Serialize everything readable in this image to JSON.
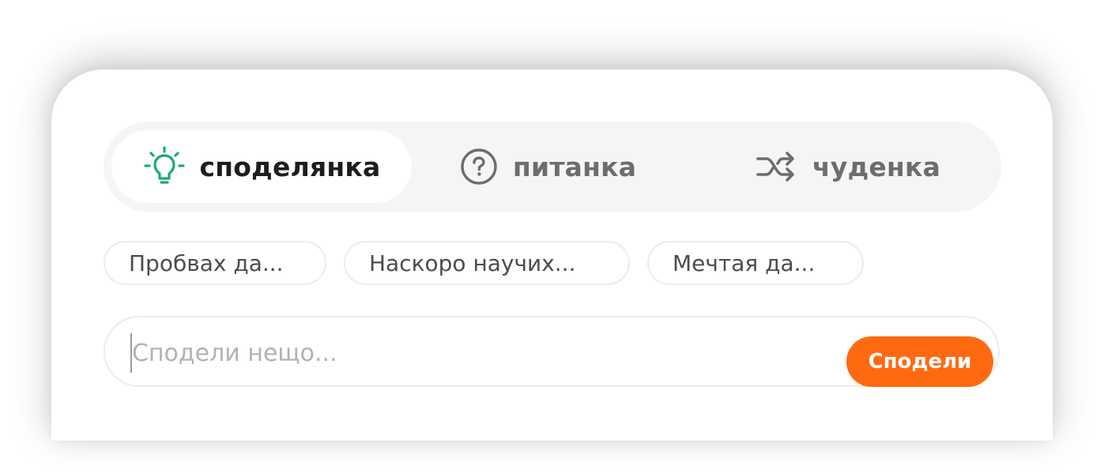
{
  "tabs": [
    {
      "label": "споделянка",
      "icon": "lightbulb-icon",
      "active": true
    },
    {
      "label": "питанка",
      "icon": "question-circle-icon",
      "active": false
    },
    {
      "label": "чуденка",
      "icon": "shuffle-icon",
      "active": false
    }
  ],
  "suggestions": [
    "Пробвах да...",
    "Наскоро научих...",
    "Мечтая да..."
  ],
  "composer": {
    "placeholder": "Сподели нещо...",
    "value": "",
    "submit_label": "Сподели"
  },
  "colors": {
    "accent": "#ff6a10",
    "active_icon": "#1aa97a",
    "tab_bar": "#f6f5f3",
    "inactive_text": "#6e6d6b"
  }
}
